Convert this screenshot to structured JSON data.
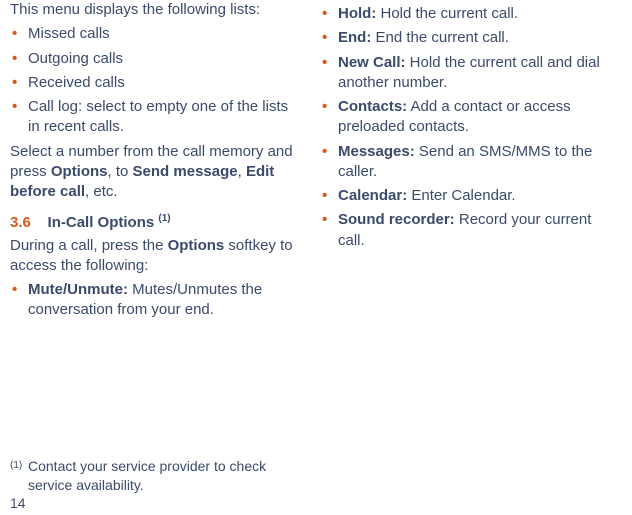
{
  "left": {
    "intro": "This menu displays the following lists:",
    "items": [
      "Missed calls",
      "Outgoing calls",
      "Received calls",
      "Call log: select to empty one of the lists in recent calls."
    ],
    "paraSelect_pre": "Select a number from the call memory and press ",
    "options_word": "Options",
    "paraSelect_mid1": ", to ",
    "send_msg": "Send message",
    "paraSelect_mid2": ", ",
    "edit_before": "Edit before call",
    "paraSelect_end": ", etc.",
    "sec_num": "3.6",
    "sec_title": "In-Call Options ",
    "sec_sup": "(1)",
    "during_pre": "During a call, press the ",
    "during_options": "Options",
    "during_post": " softkey to ac­cess the following:",
    "mute_label": "Mute/Unmute:",
    "mute_desc": " Mutes/Unmutes the conversation from your end."
  },
  "right": {
    "items": [
      {
        "label": "Hold:",
        "desc": " Hold the current call."
      },
      {
        "label": "End:",
        "desc": " End the current call."
      },
      {
        "label": "New Call:",
        "desc": " Hold the current call and dial another number."
      },
      {
        "label": "Contacts:",
        "desc": " Add a contact or access preloaded contacts."
      },
      {
        "label": "Messages:",
        "desc": " Send an SMS/MMS to the caller."
      },
      {
        "label": "Calendar:",
        "desc": " Enter Calendar."
      },
      {
        "label": "Sound recorder:",
        "desc": " Record your current call."
      }
    ]
  },
  "footnote": {
    "mark": "(1)",
    "text": "Contact your service provider to check service availability."
  },
  "page_number": "14"
}
